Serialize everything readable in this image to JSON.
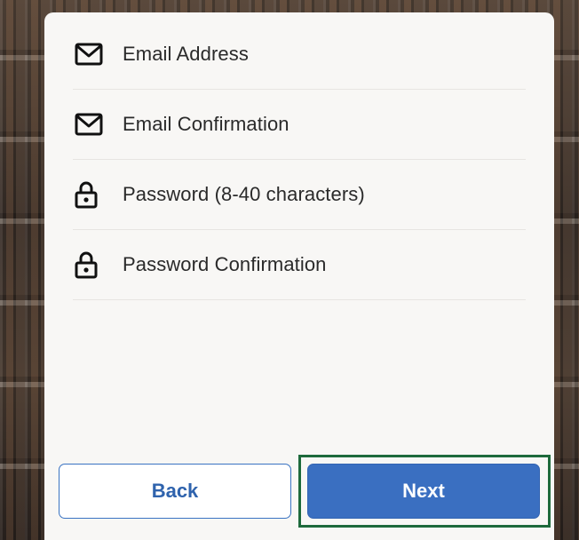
{
  "form": {
    "fields": [
      {
        "icon": "envelope-icon",
        "placeholder": "Email Address"
      },
      {
        "icon": "envelope-icon",
        "placeholder": "Email Confirmation"
      },
      {
        "icon": "lock-icon",
        "placeholder": "Password (8-40 characters)"
      },
      {
        "icon": "lock-icon",
        "placeholder": "Password Confirmation"
      }
    ]
  },
  "buttons": {
    "back_label": "Back",
    "next_label": "Next"
  },
  "colors": {
    "primary": "#3a6fc1",
    "highlight_outline": "#1e6a3c",
    "card_background": "#f8f7f5"
  }
}
